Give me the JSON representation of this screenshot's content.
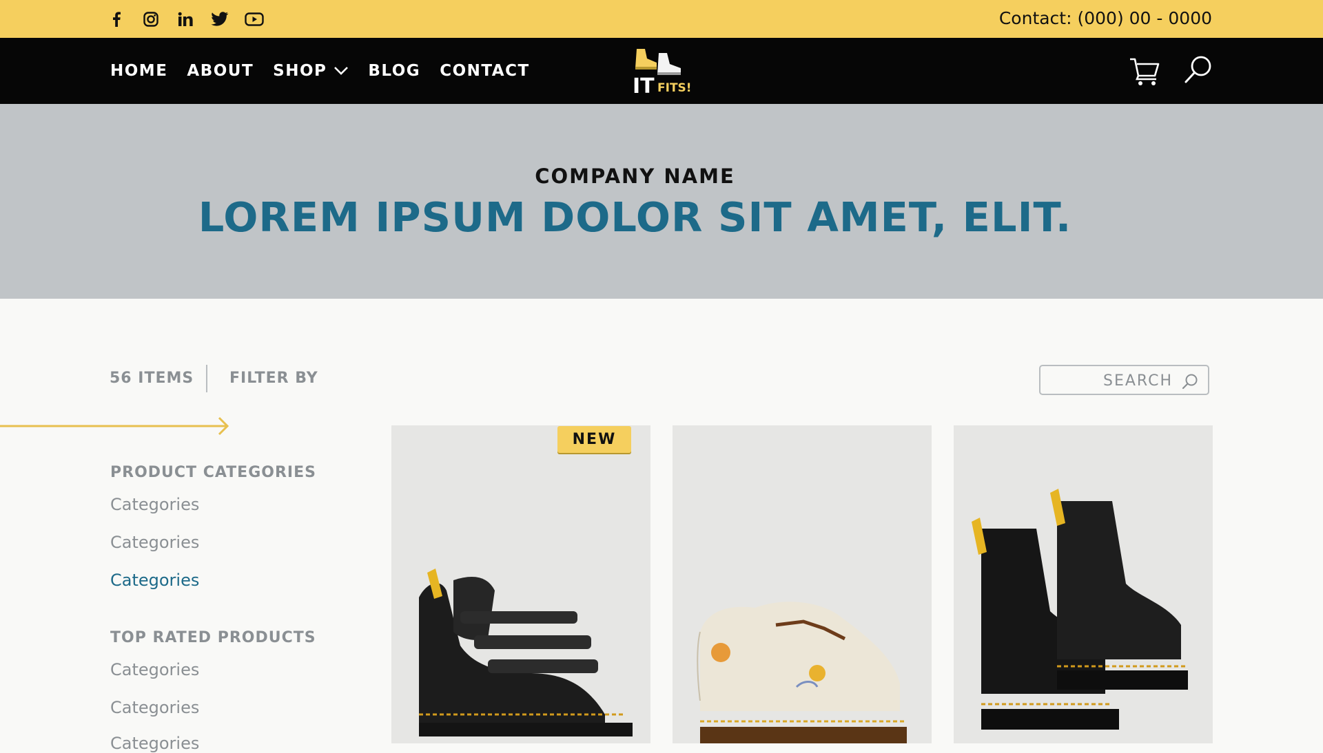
{
  "social": {
    "icons": [
      "facebook-icon",
      "instagram-icon",
      "linkedin-icon",
      "twitter-icon",
      "youtube-icon"
    ]
  },
  "topbar": {
    "contact": "Contact: (000) 00 - 0000",
    "background": "#f5cf5e"
  },
  "nav": {
    "items": [
      {
        "label": "HOME"
      },
      {
        "label": "ABOUT"
      },
      {
        "label": "SHOP",
        "has_dropdown": true
      },
      {
        "label": "BLOG"
      },
      {
        "label": "CONTACT"
      }
    ]
  },
  "logo": {
    "line1": "IT",
    "line2": "FITS!"
  },
  "hero": {
    "company": "COMPANY NAME",
    "headline": "LOREM IPSUM DOLOR SIT AMET, ELIT.",
    "headline_color": "#1d6a89"
  },
  "toolbar": {
    "items_count": "56 ITEMS",
    "filter_label": "FILTER BY",
    "search_placeholder": "SEARCH"
  },
  "sidebar": {
    "sections": [
      {
        "heading": "PRODUCT CATEGORIES",
        "links": [
          {
            "label": "Categories",
            "active": false
          },
          {
            "label": "Categories",
            "active": false
          },
          {
            "label": "Categories",
            "active": true
          }
        ]
      },
      {
        "heading": "TOP RATED PRODUCTS",
        "links": [
          {
            "label": "Categories",
            "active": false
          },
          {
            "label": "Categories",
            "active": false
          },
          {
            "label": "Categories",
            "active": false
          }
        ]
      }
    ]
  },
  "products": [
    {
      "image": "black-sandal",
      "badge": "NEW"
    },
    {
      "image": "cream-floral-shoe"
    },
    {
      "image": "black-boots"
    }
  ]
}
